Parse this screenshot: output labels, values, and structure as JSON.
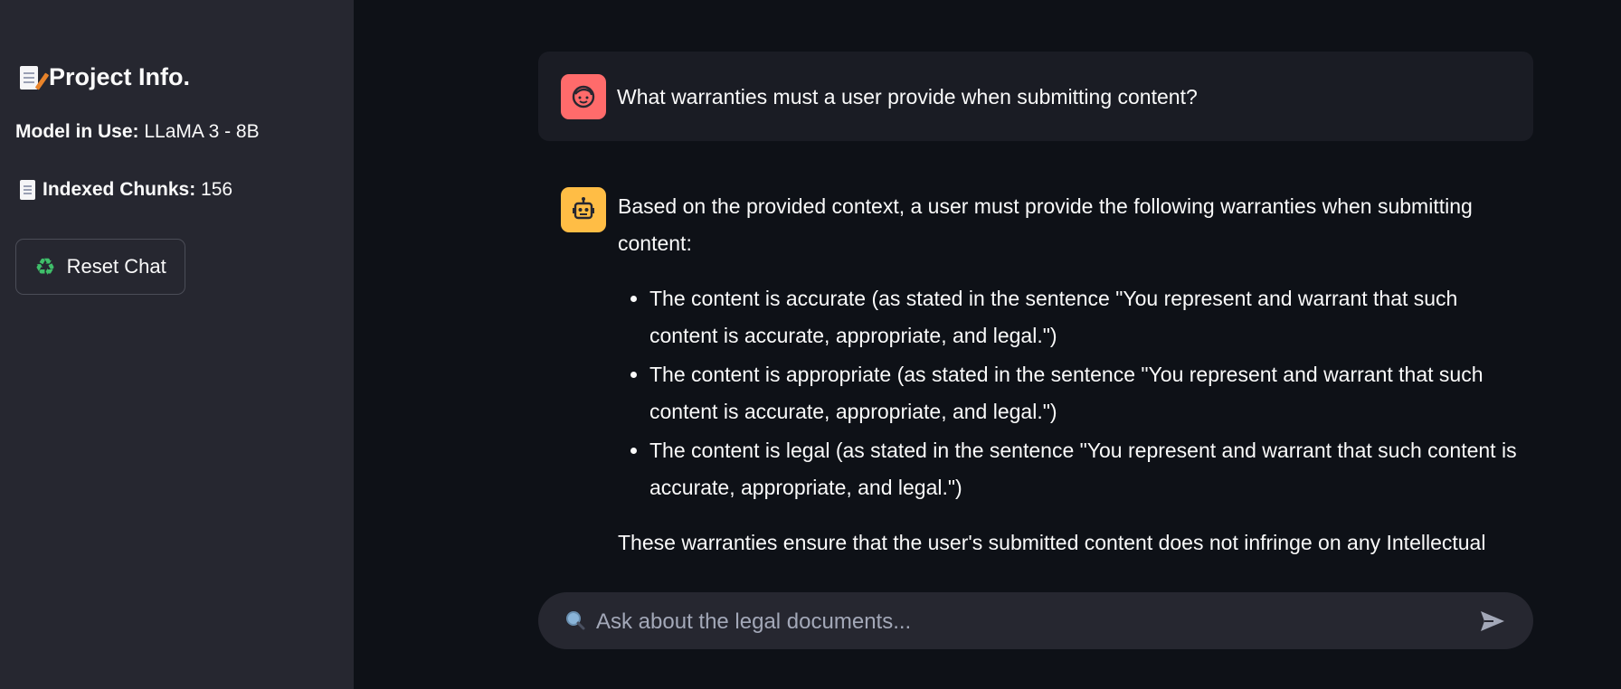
{
  "sidebar": {
    "title": "Project Info.",
    "model_label": "Model in Use:",
    "model_value": "LLaMA 3 - 8B",
    "chunks_label": "Indexed Chunks:",
    "chunks_value": "156",
    "reset_label": "Reset Chat"
  },
  "chat": {
    "user_message": "What warranties must a user provide when submitting content?",
    "bot_intro": "Based on the provided context, a user must provide the following warranties when submitting content:",
    "bot_bullets": [
      "The content is accurate (as stated in the sentence \"You represent and warrant that such content is accurate, appropriate, and legal.\")",
      "The content is appropriate (as stated in the sentence \"You represent and warrant that such content is accurate, appropriate, and legal.\")",
      "The content is legal (as stated in the sentence \"You represent and warrant that such content is accurate, appropriate, and legal.\")"
    ],
    "bot_closing": "These warranties ensure that the user's submitted content does not infringe on any Intellectual"
  },
  "input": {
    "placeholder": "Ask about the legal documents...",
    "value": ""
  },
  "colors": {
    "background": "#0e1117",
    "sidebar": "#262730",
    "user_avatar": "#ff6b6b",
    "bot_avatar": "#ffbd45"
  },
  "icons": {
    "title": "memo-icon",
    "chunks": "page-icon",
    "reset": "recycle-icon",
    "user": "user-face-icon",
    "bot": "robot-icon",
    "search": "magnifier-icon",
    "send": "send-arrow-icon"
  }
}
